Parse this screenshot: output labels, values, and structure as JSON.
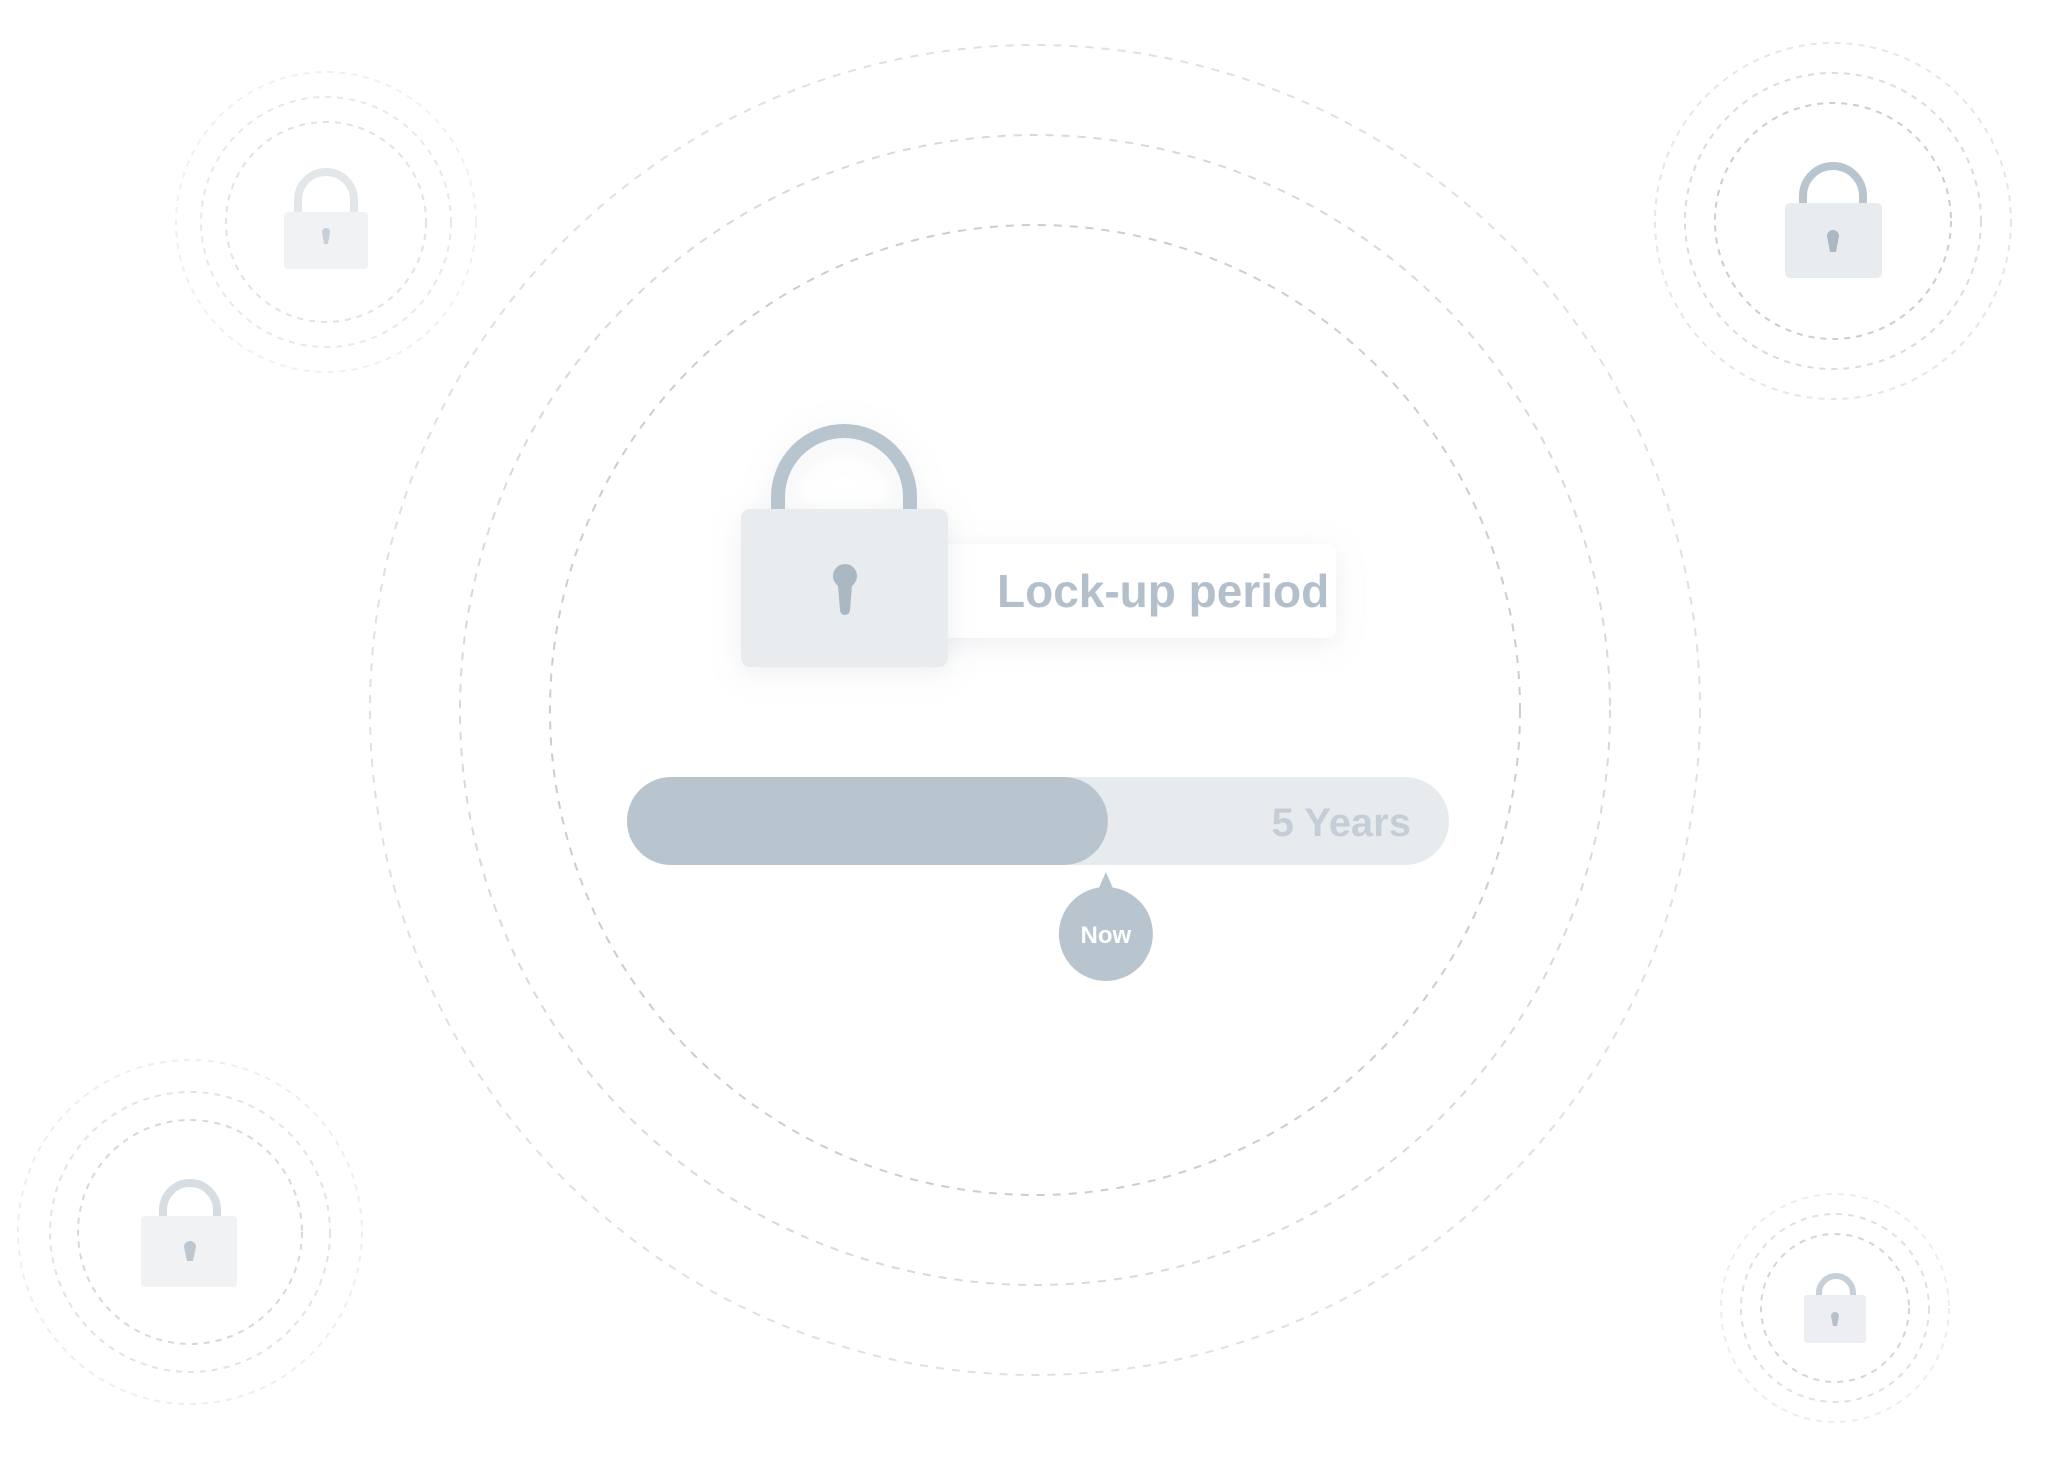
{
  "label": {
    "text": "Lock-up period"
  },
  "progress": {
    "fraction": 0.585,
    "end_label": "5 Years",
    "marker_label": "Now"
  },
  "colors": {
    "background": "#ffffff",
    "lock_body": "#e9ecef",
    "lock_body_faint": "#f1f2f4",
    "lock_accent": "#b8c5cf",
    "keyhole": "#aab8c3",
    "track": "#e8ebed",
    "fill": "#b8c5cf",
    "label_text": "#b3c0cb",
    "years_text": "#c5ced6",
    "marker_bg": "#b8c5cf",
    "marker_text": "#ffffff",
    "ring": "#c8ced4",
    "ring_faint": "#dde1e5"
  },
  "icons": [
    "lock-icon",
    "keyhole-icon",
    "speech-bubble-marker"
  ]
}
